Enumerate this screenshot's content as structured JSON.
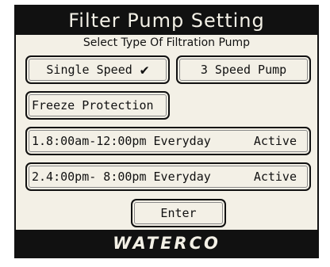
{
  "header": {
    "title": "Filter Pump Setting"
  },
  "subtitle": "Select Type Of Filtration Pump",
  "pump_types": {
    "single_label": "Single Speed",
    "single_check": "✔",
    "three_label": "3 Speed Pump"
  },
  "freeze": {
    "label": "Freeze Protection"
  },
  "schedules": [
    {
      "label": "1.8:00am-12:00pm Everyday",
      "status": "Active"
    },
    {
      "label": "2.4:00pm- 8:00pm Everyday",
      "status": "Active"
    }
  ],
  "enter": {
    "label": "Enter"
  },
  "footer": {
    "logo": "WATERCO"
  },
  "colors": {
    "background": "#f3f0e6",
    "dark": "#111111"
  },
  "icons": {
    "selected": "checkmark-icon"
  }
}
